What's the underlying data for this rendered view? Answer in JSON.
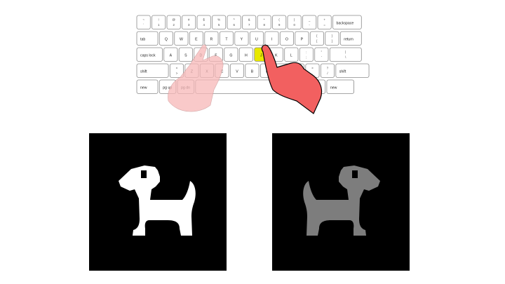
{
  "keyboard": {
    "rows": [
      [
        {
          "top": "~",
          "bottom": "`"
        },
        {
          "top": "!",
          "bottom": "1"
        },
        {
          "top": "@",
          "bottom": "2"
        },
        {
          "top": "#",
          "bottom": "3"
        },
        {
          "top": "$",
          "bottom": "4"
        },
        {
          "top": "%",
          "bottom": "5"
        },
        {
          "top": "^",
          "bottom": "6"
        },
        {
          "top": "&",
          "bottom": "7"
        },
        {
          "top": "*",
          "bottom": "8"
        },
        {
          "top": "(",
          "bottom": "9"
        },
        {
          "top": ")",
          "bottom": "0"
        },
        {
          "top": "_",
          "bottom": "-"
        },
        {
          "top": "+",
          "bottom": "="
        },
        {
          "label": "backspace"
        }
      ],
      [
        {
          "label": "tab"
        },
        {
          "label": "Q"
        },
        {
          "label": "W"
        },
        {
          "label": "E"
        },
        {
          "label": "R"
        },
        {
          "label": "T"
        },
        {
          "label": "Y"
        },
        {
          "label": "U"
        },
        {
          "label": "I"
        },
        {
          "label": "O"
        },
        {
          "label": "P"
        },
        {
          "top": "{",
          "bottom": "["
        },
        {
          "top": "}",
          "bottom": "]"
        },
        {
          "label": "return"
        }
      ],
      [
        {
          "label": "caps lock"
        },
        {
          "label": "A"
        },
        {
          "label": "S"
        },
        {
          "label": "D"
        },
        {
          "label": "F"
        },
        {
          "label": "G"
        },
        {
          "label": "H"
        },
        {
          "label": "J"
        },
        {
          "label": "K"
        },
        {
          "label": "L"
        },
        {
          "top": ":",
          "bottom": ";"
        },
        {
          "top": "\"",
          "bottom": "'"
        },
        {
          "top": "|",
          "bottom": "\\"
        }
      ],
      [
        {
          "label": "shift"
        },
        {
          "top": "<",
          "bottom": ">"
        },
        {
          "label": "Z"
        },
        {
          "label": "X"
        },
        {
          "label": "C"
        },
        {
          "label": "V"
        },
        {
          "label": "B"
        },
        {
          "label": "N"
        },
        {
          "label": "M"
        },
        {
          "top": "<",
          "bottom": ","
        },
        {
          "top": ">",
          "bottom": "."
        },
        {
          "top": "?",
          "bottom": "/"
        },
        {
          "label": "shift"
        }
      ],
      [
        {
          "label": "new"
        },
        {
          "label": "pg up"
        },
        {
          "label": "pg dn"
        },
        {
          "label": ""
        },
        {
          "label": "special"
        },
        {
          "label": "new"
        }
      ]
    ],
    "highlighted_key": "J",
    "highlight_color": "#e8e800",
    "left_hand_color": "#f7b8b8",
    "right_hand_color": "#f26060"
  },
  "panels": {
    "left": {
      "icon": "dog-icon",
      "fill": "#ffffff",
      "background": "#000000"
    },
    "right": {
      "icon": "dog-icon",
      "fill": "#7d7d7d",
      "background": "#000000"
    }
  }
}
